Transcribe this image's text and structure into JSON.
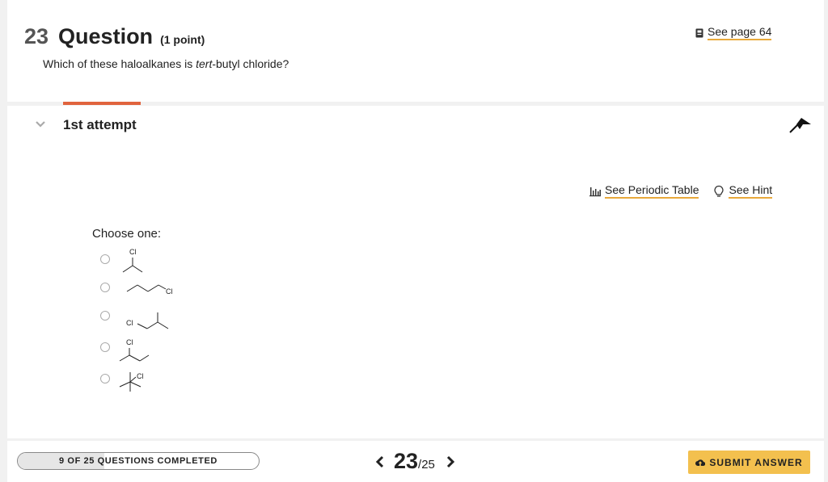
{
  "question": {
    "number": "23",
    "word": "Question",
    "points": "(1 point)",
    "prompt_before": "Which of these haloalkanes is ",
    "prompt_italic": "tert",
    "prompt_after": "-butyl chloride?",
    "see_page": "See page 64"
  },
  "attempt": {
    "title": "1st attempt",
    "tools": {
      "periodic_table": "See Periodic Table",
      "hint": "See Hint"
    },
    "choose_label": "Choose one:",
    "choices": [
      {
        "atom_label": "Cl"
      },
      {
        "atom_label": "Cl"
      },
      {
        "atom_label": "Cl"
      },
      {
        "atom_label": "Cl"
      },
      {
        "atom_label": "Cl"
      }
    ]
  },
  "footer": {
    "progress_text": "9 OF 25 QUESTIONS COMPLETED",
    "progress_fraction": 0.36,
    "current": "23",
    "total": "/25",
    "submit_label": "SUBMIT ANSWER"
  },
  "colors": {
    "accent_tab": "#e0633d",
    "link_underline": "#e8a93b",
    "submit_bg": "#f3c04e"
  },
  "icons": {
    "see_page": "book-icon",
    "periodic_table": "bar-chart-icon",
    "hint": "lightbulb-icon",
    "collapse": "collapse-arrow-icon",
    "attempt_toggle": "chevron-down-icon",
    "prev": "chevron-left-icon",
    "next": "chevron-right-icon",
    "submit": "upload-icon"
  }
}
